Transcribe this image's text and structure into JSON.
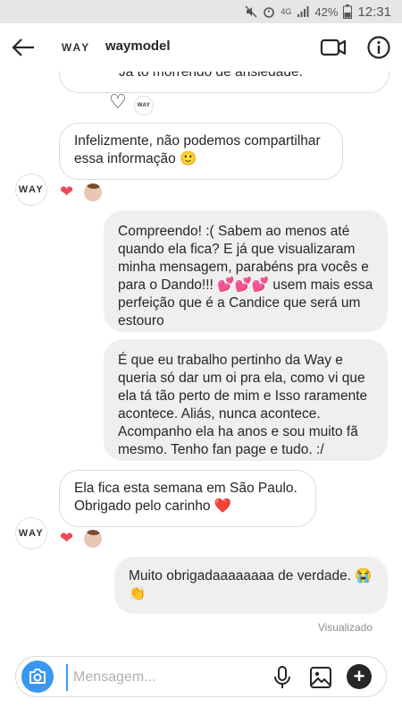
{
  "status_bar": {
    "network": "4G",
    "battery": "42%",
    "time": "12:31"
  },
  "header": {
    "avatar_text": "WAY",
    "username": "waymodel"
  },
  "messages": {
    "m0": {
      "text": "Já to morrendo de ansiedade.",
      "avatar": "WAY"
    },
    "m1": {
      "text": "Infelizmente, não podemos compartilhar essa informação 🙂",
      "avatar": "WAY"
    },
    "m2": {
      "text": "Compreendo! :( Sabem ao menos até quando ela fica? E já que visualizaram minha mensagem, parabéns pra vocês e para o Dando!!! 💕💕💕 usem mais essa perfeição que é a Candice que será um estouro"
    },
    "m3": {
      "text": "É que eu trabalho pertinho da Way e queria só dar um oi pra ela, como vi que ela tá tão perto de mim e Isso raramente acontece. Aliás, nunca acontece. Acompanho ela ha anos e sou muito fã mesmo. Tenho fan page e tudo. :/"
    },
    "m4": {
      "text": "Ela fica esta semana em São Paulo. Obrigado pelo carinho ❤️",
      "avatar": "WAY"
    },
    "m5": {
      "text": "Muito obrigadaaaaaaaa de verdade. 😭👏"
    }
  },
  "reactions": {
    "like_heart": "♡",
    "heart": "❤"
  },
  "seen_label": "Visualizado",
  "composer": {
    "placeholder": "Mensagem..."
  },
  "colors": {
    "accent": "#3897f0",
    "heart": "#ed4956",
    "outgoing_bubble": "#efefef"
  },
  "icons": [
    "back-arrow-icon",
    "video-call-icon",
    "info-icon",
    "camera-icon",
    "microphone-icon",
    "gallery-icon",
    "plus-icon"
  ]
}
